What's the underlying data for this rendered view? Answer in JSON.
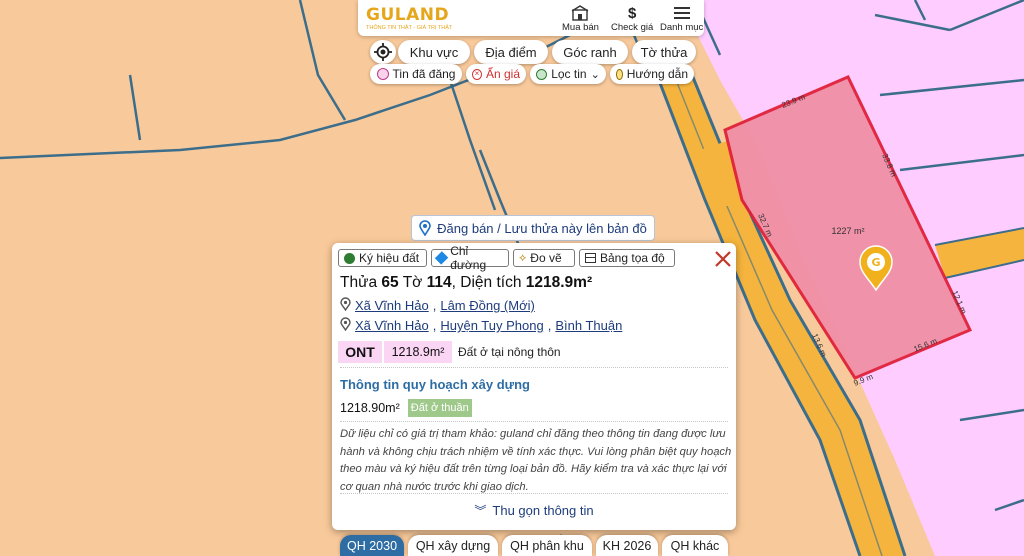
{
  "header": {
    "logo": "GULAND",
    "tagline": "THÔNG TIN THẬT - GIÁ TRỊ THẬT",
    "buttons": [
      {
        "label": "Mua bán",
        "icon": "house-icon"
      },
      {
        "label": "Check giá",
        "icon": "dollar-icon"
      },
      {
        "label": "Danh mục",
        "icon": "menu-icon"
      }
    ]
  },
  "toolbar": {
    "row1": [
      "Khu vực",
      "Địa điểm",
      "Góc ranh",
      "Tờ thửa"
    ],
    "row2": [
      {
        "label": "Tin đã đăng",
        "icon": "emoji-icon"
      },
      {
        "label": "Ẩn giá",
        "icon": "eye-off-icon"
      },
      {
        "label": "Lọc tin",
        "icon": "filter-icon"
      },
      {
        "label": "Hướng dẫn",
        "icon": "guide-icon"
      }
    ]
  },
  "post_button": "Đăng bán / Lưu thửa này lên bản đồ",
  "map": {
    "parcel_area_label": "1227 m²",
    "edge_labels": [
      "23.9 m",
      "33.8 m",
      "12.1 m",
      "15.6 m",
      "9.9 m",
      "13.6 m",
      "32.7 m"
    ],
    "colors": {
      "residential": "#ffccff",
      "agricultural": "#f8c99a",
      "road_yellow": "#f5b43d",
      "road_border": "#3c6e8c",
      "parcel_fill": "#f08fa6",
      "parcel_border": "#e0213a"
    }
  },
  "card": {
    "tools": [
      "Ký hiệu đất",
      "Chỉ đường",
      "Đo vẽ",
      "Bảng tọa độ"
    ],
    "title": {
      "prefix": "Thửa",
      "parcel_no": "65",
      "sheet_word": "Tờ",
      "sheet_no": "114",
      "area_word": ", Diện tích",
      "area": "1218.9m²"
    },
    "address_new": [
      "Xã Vĩnh Hảo",
      "Lâm Đồng (Mới)"
    ],
    "address_old": [
      "Xã Vĩnh Hảo",
      "Huyện Tuy Phong",
      "Bình Thuận"
    ],
    "land": {
      "code": "ONT",
      "area": "1218.9m²",
      "description": "Đất ở tại nông thôn"
    },
    "planning_title": "Thông tin quy hoạch xây dựng",
    "planning_area": "1218.90m²",
    "planning_badge": "Đất ở thuần",
    "disclaimer": "Dữ liệu chỉ có giá trị tham khảo: guland chỉ đăng theo thông tin đang được lưu hành và không chịu trách nhiệm về tính xác thực. Vui lòng phân biệt quy hoạch theo màu và ký hiệu đất trên từng loại bản đồ. Hãy kiểm tra và xác thực lại với cơ quan nhà nước trước khi giao dịch.",
    "collapse": "Thu gọn thông tin"
  },
  "bottom_tabs": [
    {
      "label": "QH 2030",
      "active": true
    },
    {
      "label": "QH xây dựng",
      "active": false
    },
    {
      "label": "QH phân khu",
      "active": false
    },
    {
      "label": "KH 2026",
      "active": false
    },
    {
      "label": "QH khác",
      "active": false
    }
  ]
}
